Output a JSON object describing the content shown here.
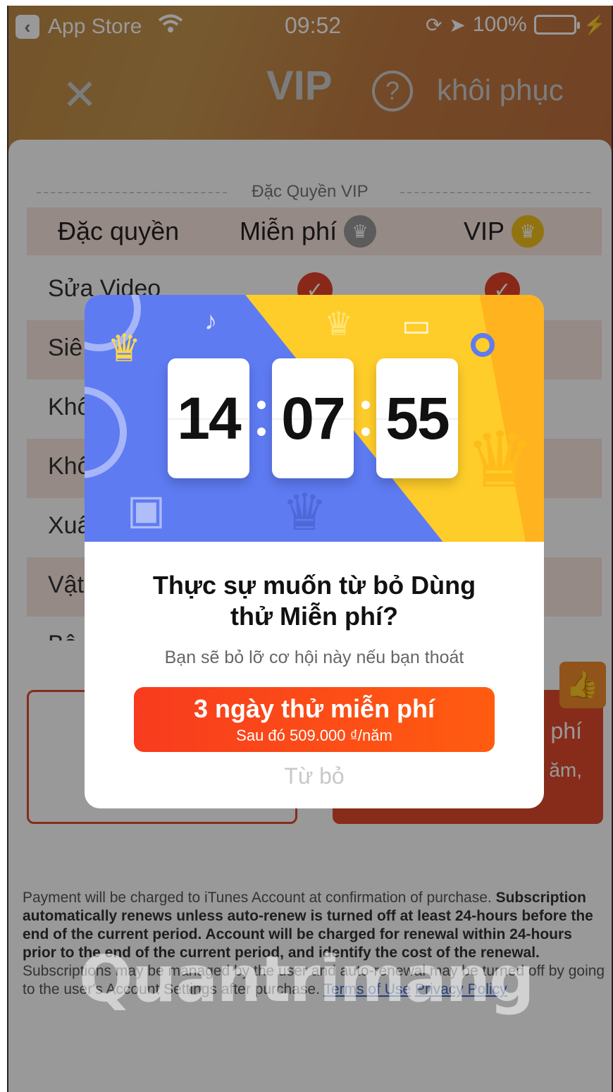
{
  "status_bar": {
    "back_app": "App Store",
    "time": "09:52",
    "battery": "100%"
  },
  "nav": {
    "close_icon": "✕",
    "title": "VIP",
    "help_icon": "?",
    "restore_label": "khôi phục"
  },
  "benefits": {
    "section_title": "Đặc Quyền VIP",
    "columns": [
      "Đặc quyền",
      "Miễn phí",
      "VIP"
    ],
    "rows": [
      {
        "label": "Sửa Video"
      },
      {
        "label": "Siê"
      },
      {
        "label": "Khô"
      },
      {
        "label": "Khô"
      },
      {
        "label": "Xuấ"
      },
      {
        "label": "Vật"
      },
      {
        "label": "Bô"
      }
    ]
  },
  "plans": {
    "right_line1": "phí",
    "right_line2": "ăm,"
  },
  "legal": {
    "line_light": "Payment will be charged to iTunes Account at confirmation of purchase.",
    "line_bold": "Subscription automatically renews unless auto-renew is turned off at least 24-hours before the end of the current period. Account will be charged for renewal within 24-hours prior to the end of the current period, and identify the cost of the renewal.",
    "line_light2": "Subscriptions may be managed by the user and auto-renewal may be turned off by going to the user's Account Settings after purchase.",
    "terms_link": "Terms of Use",
    "privacy_link": "Privacy Policy"
  },
  "modal": {
    "countdown": {
      "hours": "14",
      "minutes": "07",
      "seconds": "55"
    },
    "title": "Thực sự muốn từ bỏ Dùng thử Miễn phí?",
    "subtitle": "Bạn sẽ bỏ lỡ cơ hội này nếu bạn thoát",
    "trial_button": "3 ngày thử miễn phí",
    "trial_price": "Sau đó 509.000 ₫/năm",
    "decline": "Từ bỏ"
  },
  "watermark": "Quantrimang",
  "colors": {
    "accent": "#f83b1e",
    "banner_blue": "#5e7bf2",
    "banner_yellow": "#ffcd2a"
  }
}
